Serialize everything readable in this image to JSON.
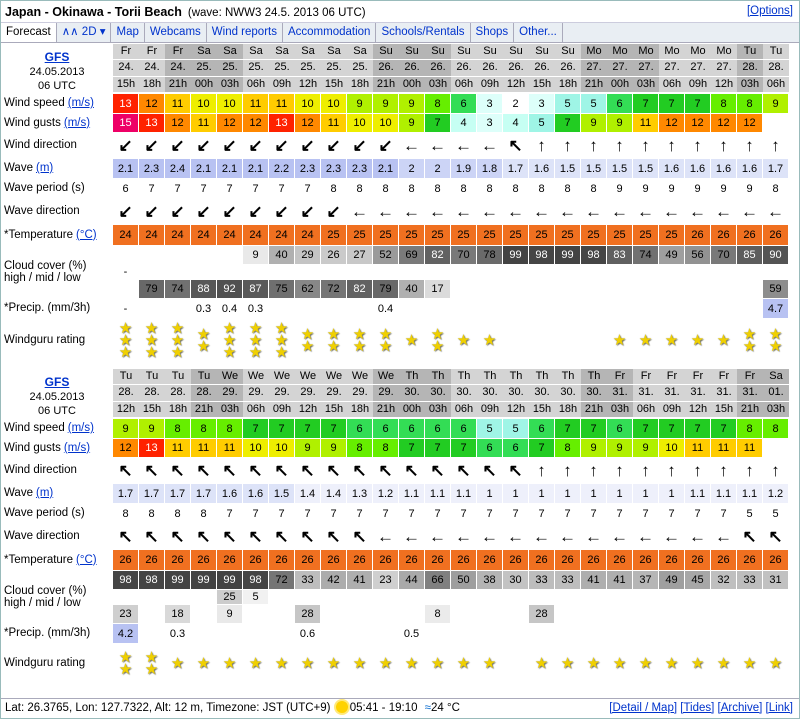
{
  "title": "Japan - Okinawa - Torii Beach",
  "wave_source": "(wave: NWW3 24.5. 2013 06 UTC)",
  "options_label": "[Options]",
  "tabs": [
    "Forecast",
    "2D",
    "Map",
    "Webcams",
    "Wind reports",
    "Accommodation",
    "Schools/Rentals",
    "Shops",
    "Other..."
  ],
  "labels": {
    "wind_speed": "Wind speed",
    "wind_gusts": "Wind gusts",
    "unit_ms": "(m/s)",
    "wind_dir": "Wind direction",
    "wave": "Wave",
    "unit_m": "(m)",
    "wave_period": "Wave period (s)",
    "wave_dir": "Wave direction",
    "temperature": "*Temperature",
    "unit_c": "(°C)",
    "cloud1": "Cloud cover (%)",
    "cloud2": "high / mid / low",
    "precip": "*Precip. (mm/3h)",
    "rating": "Windguru rating"
  },
  "colors": {
    "link": "#0033cc",
    "star": "#f0d000",
    "temp_orange": "#f07020",
    "wave_blue": "#dde3f8"
  },
  "panels": [
    {
      "model": "GFS",
      "date": "24.05.2013",
      "time": "06 UTC",
      "days": [
        "Fr",
        "Fr",
        "Fr",
        "Sa",
        "Sa",
        "Sa",
        "Sa",
        "Sa",
        "Sa",
        "Sa",
        "Su",
        "Su",
        "Su",
        "Su",
        "Su",
        "Su",
        "Su",
        "Su",
        "Mo",
        "Mo",
        "Mo",
        "Mo",
        "Mo",
        "Mo",
        "Tu",
        "Tu"
      ],
      "dates": [
        "24.",
        "24.",
        "24.",
        "25.",
        "25.",
        "25.",
        "25.",
        "25.",
        "25.",
        "25.",
        "26.",
        "26.",
        "26.",
        "26.",
        "26.",
        "26.",
        "26.",
        "26.",
        "27.",
        "27.",
        "27.",
        "27.",
        "27.",
        "27.",
        "28.",
        "28."
      ],
      "hours": [
        "15h",
        "18h",
        "21h",
        "00h",
        "03h",
        "06h",
        "09h",
        "12h",
        "15h",
        "18h",
        "21h",
        "00h",
        "03h",
        "06h",
        "09h",
        "12h",
        "15h",
        "18h",
        "21h",
        "00h",
        "03h",
        "06h",
        "09h",
        "12h",
        "03h",
        "06h"
      ],
      "wind_speed": [
        "13",
        "12",
        "11",
        "10",
        "10",
        "11",
        "11",
        "10",
        "10",
        "9",
        "9",
        "9",
        "8",
        "6",
        "3",
        "2",
        "3",
        "5",
        "5",
        "6",
        "7",
        "7",
        "7",
        "8",
        "8",
        "9"
      ],
      "wind_gusts": [
        "15",
        "13",
        "12",
        "11",
        "12",
        "12",
        "13",
        "12",
        "11",
        "10",
        "10",
        "9",
        "7",
        "4",
        "3",
        "4",
        "5",
        "7",
        "9",
        "9",
        "11",
        "12",
        "12",
        "12",
        "12",
        ""
      ],
      "wind_dir": [
        "↙",
        "↙",
        "↙",
        "↙",
        "↙",
        "↙",
        "↙",
        "↙",
        "↙",
        "↙",
        "↙",
        "←",
        "←",
        "←",
        "←",
        "↖",
        "↑",
        "↑",
        "↑",
        "↑",
        "↑",
        "↑",
        "↑",
        "↑",
        "↑",
        "↑"
      ],
      "wave": [
        "2.1",
        "2.3",
        "2.4",
        "2.1",
        "2.1",
        "2.1",
        "2.2",
        "2.3",
        "2.3",
        "2.3",
        "2.1",
        "2",
        "2",
        "1.9",
        "1.8",
        "1.7",
        "1.6",
        "1.5",
        "1.5",
        "1.5",
        "1.5",
        "1.6",
        "1.6",
        "1.6",
        "1.6",
        "1.7"
      ],
      "wave_period": [
        "6",
        "7",
        "7",
        "7",
        "7",
        "7",
        "7",
        "7",
        "8",
        "8",
        "8",
        "8",
        "8",
        "8",
        "8",
        "8",
        "8",
        "8",
        "8",
        "9",
        "9",
        "9",
        "9",
        "9",
        "9",
        "8"
      ],
      "wave_dir": [
        "↙",
        "↙",
        "↙",
        "↙",
        "↙",
        "↙",
        "↙",
        "↙",
        "↙",
        "←",
        "←",
        "←",
        "←",
        "←",
        "←",
        "←",
        "←",
        "←",
        "←",
        "←",
        "←",
        "←",
        "←",
        "←",
        "←",
        "←"
      ],
      "temperature": [
        "24",
        "24",
        "24",
        "24",
        "24",
        "24",
        "24",
        "24",
        "25",
        "25",
        "25",
        "25",
        "25",
        "25",
        "25",
        "25",
        "25",
        "25",
        "25",
        "25",
        "25",
        "25",
        "26",
        "26",
        "26",
        "26"
      ],
      "cloud_high": [
        "",
        "",
        "",
        "",
        "",
        "9",
        "40",
        "29",
        "26",
        "27",
        "52",
        "69",
        "82",
        "70",
        "78",
        "99",
        "98",
        "99",
        "98",
        "83",
        "74",
        "49",
        "56",
        "70",
        "85",
        "90"
      ],
      "cloud_mid": [
        "-",
        "",
        "",
        "",
        "",
        "",
        "",
        "",
        "",
        "",
        "",
        "",
        "",
        "",
        "",
        "",
        "",
        "",
        "",
        "",
        "",
        "",
        "",
        "",
        "",
        ""
      ],
      "cloud_low": [
        "",
        "79",
        "74",
        "88",
        "92",
        "87",
        "75",
        "62",
        "72",
        "82",
        "79",
        "40",
        "17",
        "",
        "",
        "",
        "",
        "",
        "",
        "",
        "",
        "",
        "",
        "",
        "",
        "59"
      ],
      "precip": [
        "-",
        "",
        "",
        "0.3",
        "0.4",
        "0.3",
        "",
        "",
        "",
        "",
        "0.4",
        "",
        "",
        "",
        "",
        "",
        "",
        "",
        "",
        "",
        "",
        "",
        "",
        "",
        "",
        "4.7"
      ],
      "rating": [
        3,
        3,
        3,
        2,
        3,
        3,
        3,
        2,
        2,
        2,
        2,
        1,
        2,
        1,
        1,
        0,
        0,
        0,
        0,
        1,
        1,
        1,
        1,
        1,
        2,
        2
      ]
    },
    {
      "model": "GFS",
      "date": "24.05.2013",
      "time": "06 UTC",
      "days": [
        "Tu",
        "Tu",
        "Tu",
        "Tu",
        "We",
        "We",
        "We",
        "We",
        "We",
        "We",
        "We",
        "Th",
        "Th",
        "Th",
        "Th",
        "Th",
        "Th",
        "Th",
        "Th",
        "Fr",
        "Fr",
        "Fr",
        "Fr",
        "Fr",
        "Fr",
        "Sa"
      ],
      "dates": [
        "28.",
        "28.",
        "28.",
        "28.",
        "29.",
        "29.",
        "29.",
        "29.",
        "29.",
        "29.",
        "29.",
        "30.",
        "30.",
        "30.",
        "30.",
        "30.",
        "30.",
        "30.",
        "30.",
        "31.",
        "31.",
        "31.",
        "31.",
        "31.",
        "31.",
        "01."
      ],
      "hours": [
        "12h",
        "15h",
        "18h",
        "21h",
        "03h",
        "06h",
        "09h",
        "12h",
        "15h",
        "18h",
        "21h",
        "00h",
        "03h",
        "06h",
        "09h",
        "12h",
        "15h",
        "18h",
        "21h",
        "03h",
        "06h",
        "09h",
        "12h",
        "15h",
        "21h",
        "03h"
      ],
      "wind_speed": [
        "9",
        "9",
        "8",
        "8",
        "8",
        "7",
        "7",
        "7",
        "7",
        "6",
        "6",
        "6",
        "6",
        "6",
        "5",
        "5",
        "6",
        "7",
        "7",
        "6",
        "7",
        "7",
        "7",
        "7",
        "8",
        "8"
      ],
      "wind_gusts": [
        "12",
        "13",
        "11",
        "11",
        "11",
        "10",
        "10",
        "9",
        "9",
        "8",
        "8",
        "7",
        "7",
        "7",
        "6",
        "6",
        "7",
        "8",
        "9",
        "9",
        "9",
        "10",
        "11",
        "11",
        "11",
        ""
      ],
      "wind_dir": [
        "↖",
        "↖",
        "↖",
        "↖",
        "↖",
        "↖",
        "↖",
        "↖",
        "↖",
        "↖",
        "↖",
        "↖",
        "↖",
        "↖",
        "↖",
        "↖",
        "↑",
        "↑",
        "↑",
        "↑",
        "↑",
        "↑",
        "↑",
        "↑",
        "↑",
        "↑"
      ],
      "wave": [
        "1.7",
        "1.7",
        "1.7",
        "1.7",
        "1.6",
        "1.6",
        "1.5",
        "1.4",
        "1.4",
        "1.3",
        "1.2",
        "1.1",
        "1.1",
        "1.1",
        "1",
        "1",
        "1",
        "1",
        "1",
        "1",
        "1",
        "1",
        "1.1",
        "1.1",
        "1.1",
        "1.2"
      ],
      "wave_period": [
        "8",
        "8",
        "8",
        "8",
        "7",
        "7",
        "7",
        "7",
        "7",
        "7",
        "7",
        "7",
        "7",
        "7",
        "7",
        "7",
        "7",
        "7",
        "7",
        "7",
        "7",
        "7",
        "7",
        "7",
        "5",
        "5"
      ],
      "wave_dir": [
        "↖",
        "↖",
        "↖",
        "↖",
        "↖",
        "↖",
        "↖",
        "↖",
        "↖",
        "↖",
        "←",
        "←",
        "←",
        "←",
        "←",
        "←",
        "←",
        "←",
        "←",
        "←",
        "←",
        "←",
        "←",
        "←",
        "↖",
        "↖"
      ],
      "temperature": [
        "26",
        "26",
        "26",
        "26",
        "26",
        "26",
        "26",
        "26",
        "26",
        "26",
        "26",
        "26",
        "26",
        "26",
        "26",
        "26",
        "26",
        "26",
        "26",
        "26",
        "26",
        "26",
        "26",
        "26",
        "26",
        "26"
      ],
      "cloud_high": [
        "98",
        "98",
        "99",
        "99",
        "99",
        "98",
        "72",
        "33",
        "42",
        "41",
        "23",
        "44",
        "66",
        "50",
        "38",
        "30",
        "33",
        "33",
        "41",
        "41",
        "37",
        "49",
        "45",
        "32",
        "33",
        "31"
      ],
      "cloud_mid": [
        "",
        "",
        "",
        "",
        "25",
        "5",
        "",
        "",
        "",
        "",
        "",
        "",
        "",
        "",
        "",
        "",
        "",
        "",
        "",
        "",
        "",
        "",
        "",
        "",
        "",
        ""
      ],
      "cloud_low": [
        "23",
        "",
        "18",
        "",
        "9",
        "",
        "",
        "28",
        "",
        "",
        "",
        "",
        "8",
        "",
        "",
        "",
        "28",
        "",
        "",
        "",
        "",
        "",
        "",
        "",
        "",
        ""
      ],
      "precip": [
        "4.2",
        "",
        "0.3",
        "",
        "",
        "",
        "",
        "0.6",
        "",
        "",
        "",
        "0.5",
        "",
        "",
        "",
        "",
        "",
        "",
        "",
        "",
        "",
        "",
        "",
        "",
        "",
        ""
      ],
      "rating": [
        2,
        2,
        1,
        1,
        1,
        1,
        1,
        1,
        1,
        1,
        1,
        1,
        1,
        1,
        1,
        0,
        1,
        1,
        1,
        1,
        1,
        1,
        1,
        1,
        1,
        1
      ]
    }
  ],
  "footer": {
    "lat": "Lat: 26.3765, Lon: 127.7322, Alt: 12 m, Timezone: JST (UTC+9)",
    "sun": "05:41 - 19:10",
    "water": "24 °C",
    "links": [
      "[Detail / Map]",
      "[Tides]",
      "[Archive]",
      "[Link]"
    ]
  }
}
